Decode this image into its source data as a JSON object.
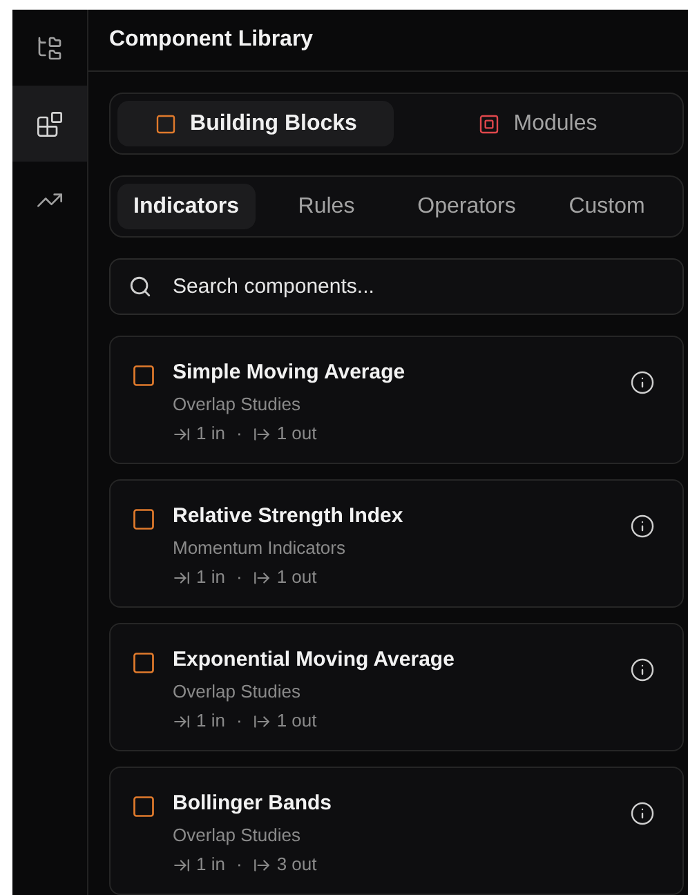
{
  "rail": [
    {
      "kind": "tree",
      "selected": false
    },
    {
      "kind": "blocks",
      "selected": true
    },
    {
      "kind": "trend",
      "selected": false
    }
  ],
  "panel": {
    "title": "Component Library"
  },
  "segments": [
    {
      "label": "Building Blocks",
      "kind": "block",
      "color": "#e07a2c",
      "selected": true
    },
    {
      "label": "Modules",
      "kind": "module",
      "color": "#e0474c",
      "selected": false
    }
  ],
  "tabs": [
    {
      "label": "Indicators",
      "selected": true
    },
    {
      "label": "Rules",
      "selected": false
    },
    {
      "label": "Operators",
      "selected": false
    },
    {
      "label": "Custom",
      "selected": false
    }
  ],
  "search": {
    "placeholder": "Search components..."
  },
  "components": [
    {
      "title": "Simple Moving Average",
      "category": "Overlap Studies",
      "inputs": "1 in",
      "separator": "·",
      "outputs": "1 out"
    },
    {
      "title": "Relative Strength Index",
      "category": "Momentum Indicators",
      "inputs": "1 in",
      "separator": "·",
      "outputs": "1 out"
    },
    {
      "title": "Exponential Moving Average",
      "category": "Overlap Studies",
      "inputs": "1 in",
      "separator": "·",
      "outputs": "1 out"
    },
    {
      "title": "Bollinger Bands",
      "category": "Overlap Studies",
      "inputs": "1 in",
      "separator": "·",
      "outputs": "3 out"
    }
  ]
}
